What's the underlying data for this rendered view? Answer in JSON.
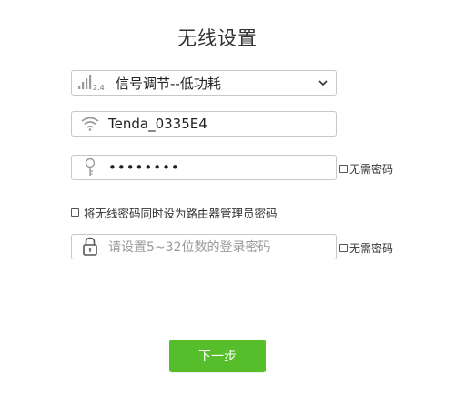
{
  "title": "无线设置",
  "signal": {
    "band_label": "2.4",
    "selected_option": "信号调节--低功耗"
  },
  "ssid": {
    "value": "Tenda_0335E4"
  },
  "wifi_password": {
    "value": "••••••••",
    "no_password_label": "无需密码"
  },
  "sync_admin": {
    "label": "将无线密码同时设为路由器管理员密码"
  },
  "login_password": {
    "placeholder": "请设置5~32位数的登录密码",
    "no_password_label": "无需密码"
  },
  "next_button": {
    "label": "下一步"
  },
  "colors": {
    "accent": "#56be2a",
    "border": "#c8c8c8",
    "icon": "#9a9a9a"
  },
  "icons": {
    "signal": "signal-strength-icon",
    "wifi": "wifi-icon",
    "key": "key-icon",
    "lock": "lock-icon",
    "dropdown": "chevron-down-icon"
  }
}
